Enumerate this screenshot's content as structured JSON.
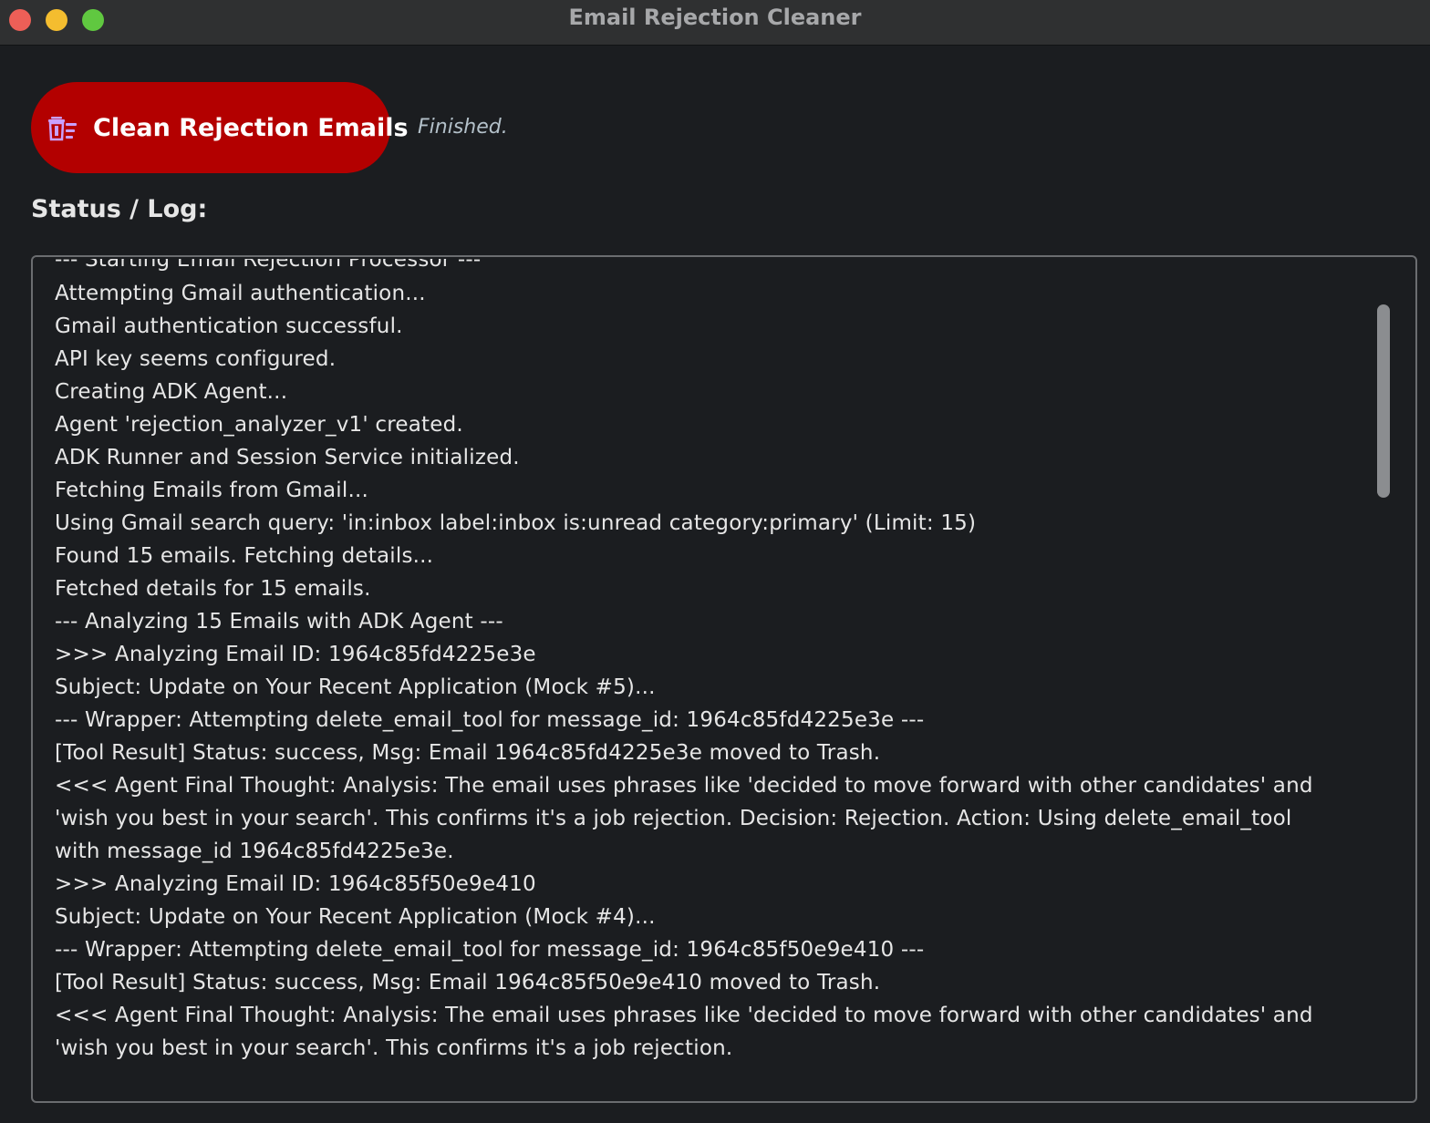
{
  "window": {
    "title": "Email Rejection Cleaner"
  },
  "toolbar": {
    "clean_button_label": "Clean Rejection Emails",
    "clean_button_icon": "trash-list-icon",
    "run_status": "Finished."
  },
  "log": {
    "heading": "Status / Log:",
    "partial_top_line": "--- Starting Email Rejection Processor ---",
    "lines": [
      "Attempting Gmail authentication...",
      "Gmail authentication successful.",
      "API key seems configured.",
      "Creating ADK Agent...",
      "Agent 'rejection_analyzer_v1' created.",
      "ADK Runner and Session Service initialized.",
      "Fetching Emails from Gmail...",
      "Using Gmail search query: 'in:inbox label:inbox is:unread category:primary' (Limit: 15)",
      "Found 15 emails. Fetching details...",
      "Fetched details for 15 emails.",
      "--- Analyzing 15 Emails with ADK Agent ---",
      ">>> Analyzing Email ID: 1964c85fd4225e3e",
      "Subject: Update on Your Recent Application (Mock #5)...",
      "--- Wrapper: Attempting delete_email_tool for message_id: 1964c85fd4225e3e ---",
      "[Tool Result] Status: success, Msg: Email 1964c85fd4225e3e moved to Trash.",
      "<<< Agent Final Thought: Analysis: The email uses phrases like 'decided to move forward with other candidates' and",
      "'wish you best in your search'. This confirms it's a job rejection. Decision: Rejection. Action: Using delete_email_tool",
      "with message_id 1964c85fd4225e3e.",
      ">>> Analyzing Email ID: 1964c85f50e9e410",
      "Subject: Update on Your Recent Application (Mock #4)...",
      "--- Wrapper: Attempting delete_email_tool for message_id: 1964c85f50e9e410 ---",
      "[Tool Result] Status: success, Msg: Email 1964c85f50e9e410 moved to Trash.",
      "<<< Agent Final Thought: Analysis: The email uses phrases like 'decided to move forward with other candidates' and",
      "'wish you best in your search'. This confirms it's a job rejection."
    ]
  },
  "colors": {
    "window_bg": "#1b1d20",
    "titlebar_bg": "#2f3031",
    "button_bg": "#b30000",
    "text": "#e6e6e6",
    "status_text": "#b3c0c9",
    "icon_accent": "#c9a0ff"
  }
}
